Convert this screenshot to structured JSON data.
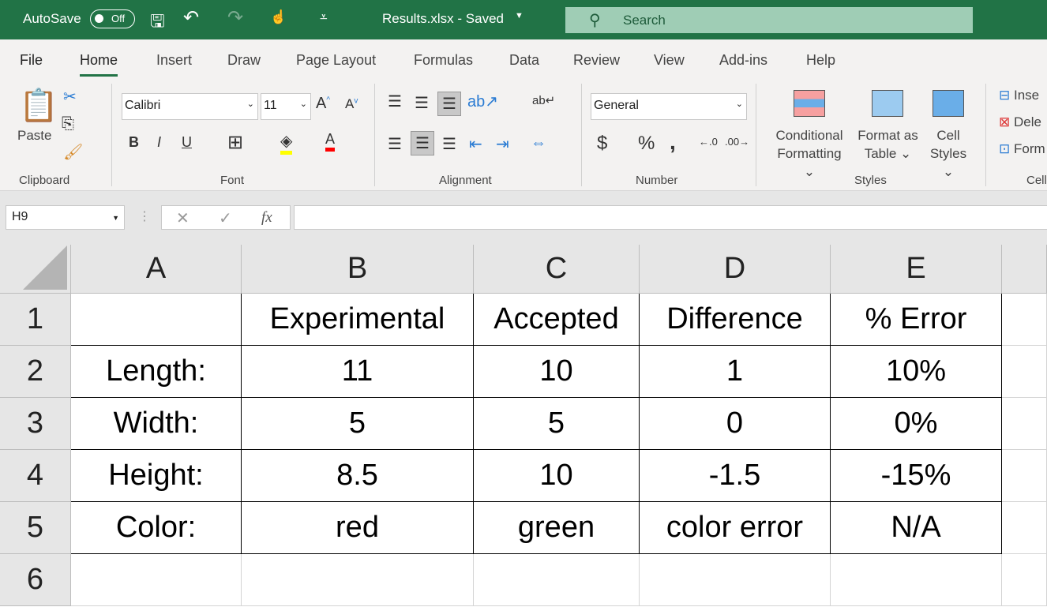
{
  "titlebar": {
    "autosave_label": "AutoSave",
    "autosave_state": "Off",
    "filename": "Results.xlsx  -  Saved",
    "search_placeholder": "Search"
  },
  "tabs": [
    "File",
    "Home",
    "Insert",
    "Draw",
    "Page Layout",
    "Formulas",
    "Data",
    "Review",
    "View",
    "Add-ins",
    "Help"
  ],
  "active_tab": "Home",
  "ribbon": {
    "clipboard": {
      "paste": "Paste",
      "group": "Clipboard"
    },
    "font": {
      "name": "Calibri",
      "size": "11",
      "bold": "B",
      "italic": "I",
      "underline": "U",
      "group": "Font"
    },
    "alignment": {
      "group": "Alignment"
    },
    "number": {
      "format": "General",
      "currency": "$",
      "percent": "%",
      "comma": ",",
      "group": "Number"
    },
    "styles": {
      "conditional": "Conditional",
      "conditional2": "Formatting",
      "format_as": "Format as",
      "format_as2": "Table",
      "cell": "Cell",
      "cell2": "Styles",
      "group": "Styles"
    },
    "cells": {
      "insert": "Inse",
      "delete": "Dele",
      "format": "Form",
      "group": "Cell"
    }
  },
  "formula_bar": {
    "name_box": "H9",
    "fx": "fx",
    "value": ""
  },
  "sheet": {
    "columns": [
      "A",
      "B",
      "C",
      "D",
      "E"
    ],
    "rows": [
      "1",
      "2",
      "3",
      "4",
      "5",
      "6"
    ],
    "cells": [
      [
        "",
        "Experimental",
        "Accepted",
        "Difference",
        "% Error"
      ],
      [
        "Length:",
        "11",
        "10",
        "1",
        "10%"
      ],
      [
        "Width:",
        "5",
        "5",
        "0",
        "0%"
      ],
      [
        "Height:",
        "8.5",
        "10",
        "-1.5",
        "-15%"
      ],
      [
        "Color:",
        "red",
        "green",
        "color error",
        "N/A"
      ],
      [
        "",
        "",
        "",
        "",
        ""
      ]
    ]
  },
  "colors": {
    "brand": "#217346",
    "search": "#9fcdb5",
    "highlight": "#ffff00",
    "font_color": "#ff0000"
  }
}
